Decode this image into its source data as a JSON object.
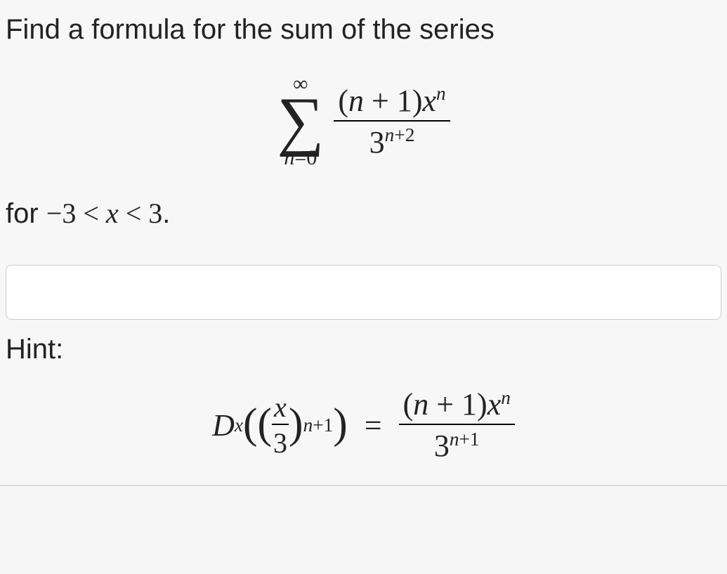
{
  "prompt": "Find a formula for the sum of the series",
  "sigma": {
    "top": "∞",
    "bottom_lhs": "n",
    "bottom_eq": "=",
    "bottom_rhs": "0"
  },
  "main_frac": {
    "num_open": "(",
    "num_n": "n",
    "num_plus": " + 1",
    "num_close": ")",
    "num_x": "x",
    "num_exp": "n",
    "den_base": "3",
    "den_exp_a": "n",
    "den_exp_plus": "+2"
  },
  "for_text": "for ",
  "interval": {
    "neg3": "−3",
    "lt1": " < ",
    "x": "x",
    "lt2": " < ",
    "three": "3",
    "dot": "."
  },
  "answer_value": "",
  "answer_placeholder": "",
  "hint_label": "Hint:",
  "hint": {
    "D": "D",
    "Dsub": "x",
    "open1": "(",
    "open2": "(",
    "frac_num": "x",
    "frac_den": "3",
    "close2": ")",
    "exp_n": "n",
    "exp_plus": "+1",
    "close1": ")",
    "eq": "=",
    "r_num_open": "(",
    "r_num_n": "n",
    "r_num_plus": " + 1",
    "r_num_close": ")",
    "r_num_x": "x",
    "r_num_exp": "n",
    "r_den_base": "3",
    "r_den_exp_n": "n",
    "r_den_exp_plus": "+1"
  }
}
